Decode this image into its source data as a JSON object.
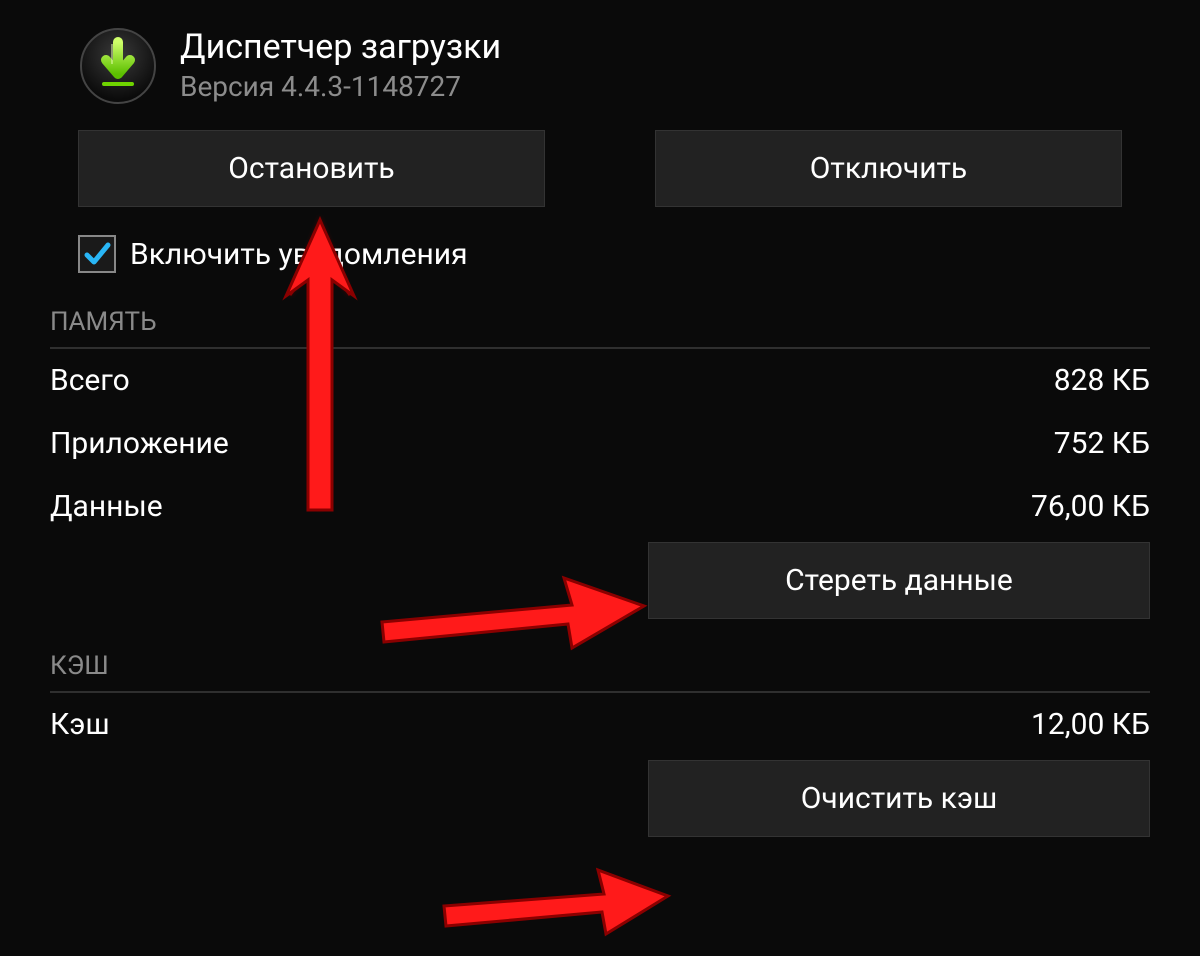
{
  "app": {
    "title": "Диспетчер загрузки",
    "version": "Версия 4.4.3-1148727"
  },
  "buttons": {
    "stop": "Остановить",
    "disable": "Отключить",
    "clear_data": "Стереть данные",
    "clear_cache": "Очистить кэш"
  },
  "checkbox": {
    "notifications_label": "Включить уведомления",
    "checked": true
  },
  "sections": {
    "memory_header": "ПАМЯТЬ",
    "cache_header": "КЭШ"
  },
  "memory": {
    "total_label": "Всего",
    "total_value": "828 КБ",
    "app_label": "Приложение",
    "app_value": "752 КБ",
    "data_label": "Данные",
    "data_value": "76,00 КБ"
  },
  "cache": {
    "label": "Кэш",
    "value": "12,00 КБ"
  }
}
